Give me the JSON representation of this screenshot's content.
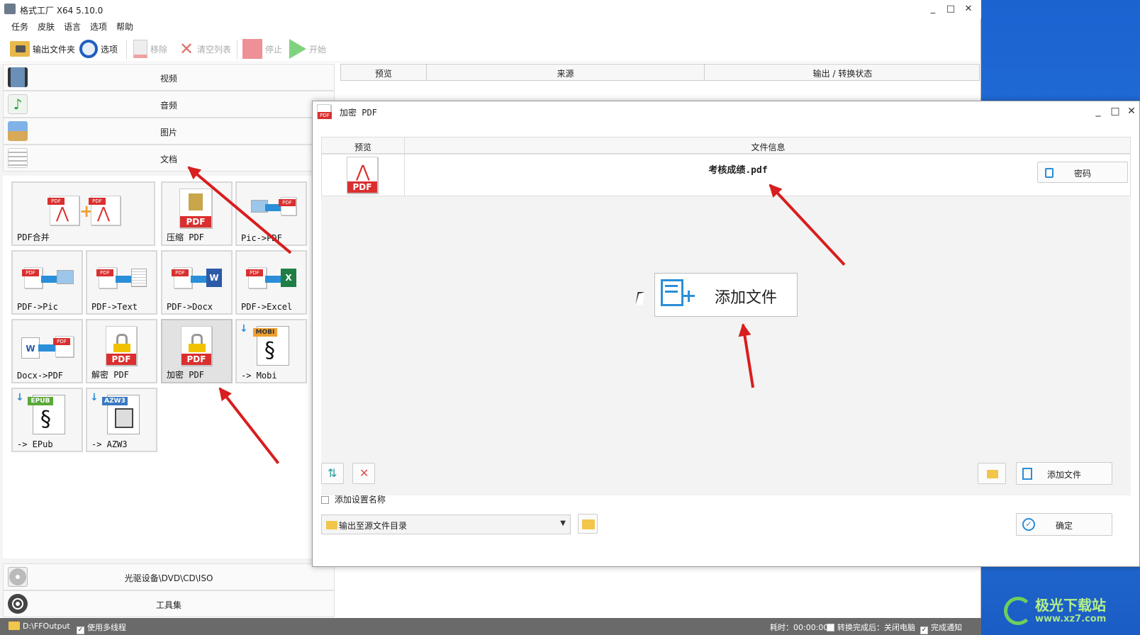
{
  "app": {
    "title": "格式工厂 X64 5.10.0",
    "window_controls": {
      "minimize": "_",
      "maximize": "□",
      "close": "✕"
    }
  },
  "menu": [
    "任务",
    "皮肤",
    "语言",
    "选项",
    "帮助"
  ],
  "toolbar": {
    "output_folder": "输出文件夹",
    "options": "选项",
    "remove": "移除",
    "clear_list": "清空列表",
    "stop": "停止",
    "start": "开始"
  },
  "categories": {
    "video": "视频",
    "audio": "音频",
    "image": "图片",
    "document": "文档",
    "disc": "光驱设备\\DVD\\CD\\ISO",
    "tools": "工具集"
  },
  "tiles": [
    {
      "label": "PDF合并",
      "icon": "pdf-merge-icon"
    },
    {
      "label": "压缩 PDF",
      "icon": "pdf-compress-icon"
    },
    {
      "label": "Pic->PDF",
      "icon": "pic-to-pdf-icon"
    },
    {
      "label": "PDF->Pic",
      "icon": "pdf-to-pic-icon"
    },
    {
      "label": "PDF->Text",
      "icon": "pdf-to-text-icon"
    },
    {
      "label": "PDF->Docx",
      "icon": "pdf-to-docx-icon"
    },
    {
      "label": "PDF->Excel",
      "icon": "pdf-to-excel-icon"
    },
    {
      "label": "Docx->PDF",
      "icon": "docx-to-pdf-icon"
    },
    {
      "label": "解密 PDF",
      "icon": "pdf-decrypt-icon"
    },
    {
      "label": "加密 PDF",
      "icon": "pdf-encrypt-icon",
      "selected": true
    },
    {
      "label": "-> Mobi",
      "icon": "mobi-icon",
      "badge": "MOBI"
    },
    {
      "label": "-> EPub",
      "icon": "epub-icon",
      "badge": "EPUB"
    },
    {
      "label": "-> AZW3",
      "icon": "azw3-icon",
      "badge": "AZW3"
    }
  ],
  "pdf_text": "PDF",
  "task_table": {
    "columns": [
      "预览",
      "来源",
      "输出 / 转换状态"
    ]
  },
  "status": {
    "output_path": "D:\\FFOutput",
    "multithread": "使用多线程",
    "elapsed": "耗时：00:00:00",
    "after_convert": "转换完成后：关闭电脑",
    "notify": "完成通知"
  },
  "dialog": {
    "title": "加密 PDF",
    "columns": [
      "预览",
      "文件信息"
    ],
    "file_name": "考核成绩.pdf",
    "password_button": "密码",
    "add_file_big": "添加文件",
    "add_file_button": "添加文件",
    "add_setting_name": "添加设置名称",
    "output_select": "输出至源文件目录",
    "ok_button": "确定"
  },
  "watermark": {
    "line1": "极光下载站",
    "line2": "www.xz7.com"
  },
  "colors": {
    "accent_blue": "#2a8ed8",
    "pdf_red": "#d9302f",
    "arrow_red": "#d81e1e",
    "statusbar": "#6a6a6a"
  }
}
